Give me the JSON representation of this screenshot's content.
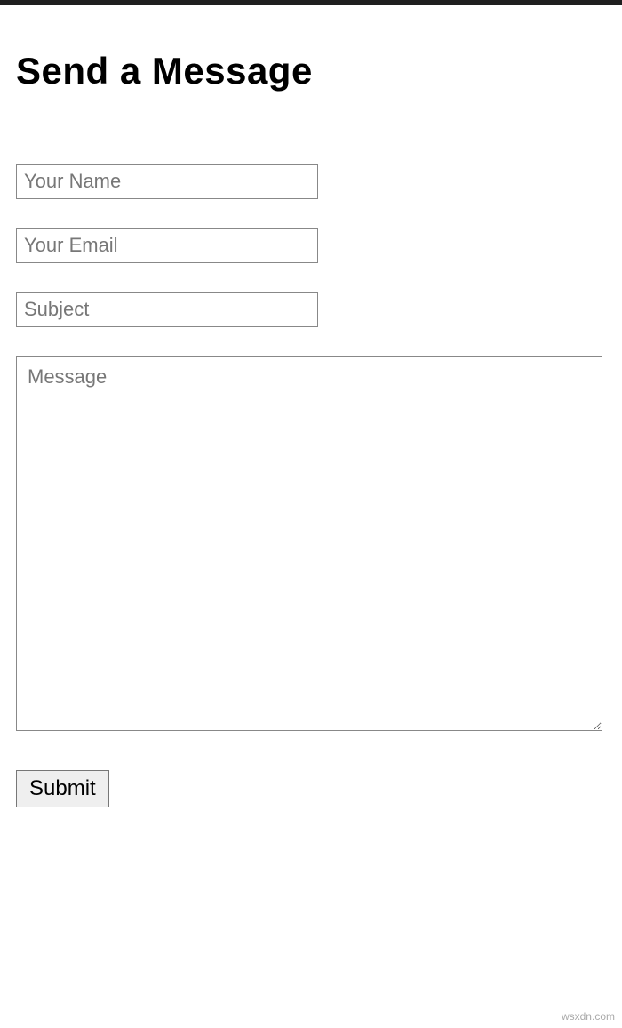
{
  "header": {
    "title": "Send a Message"
  },
  "form": {
    "name": {
      "placeholder": "Your Name",
      "value": ""
    },
    "email": {
      "placeholder": "Your Email",
      "value": ""
    },
    "subject": {
      "placeholder": "Subject",
      "value": ""
    },
    "message": {
      "placeholder": "Message",
      "value": ""
    },
    "submit_label": "Submit"
  },
  "footer": {
    "watermark": "wsxdn.com"
  }
}
